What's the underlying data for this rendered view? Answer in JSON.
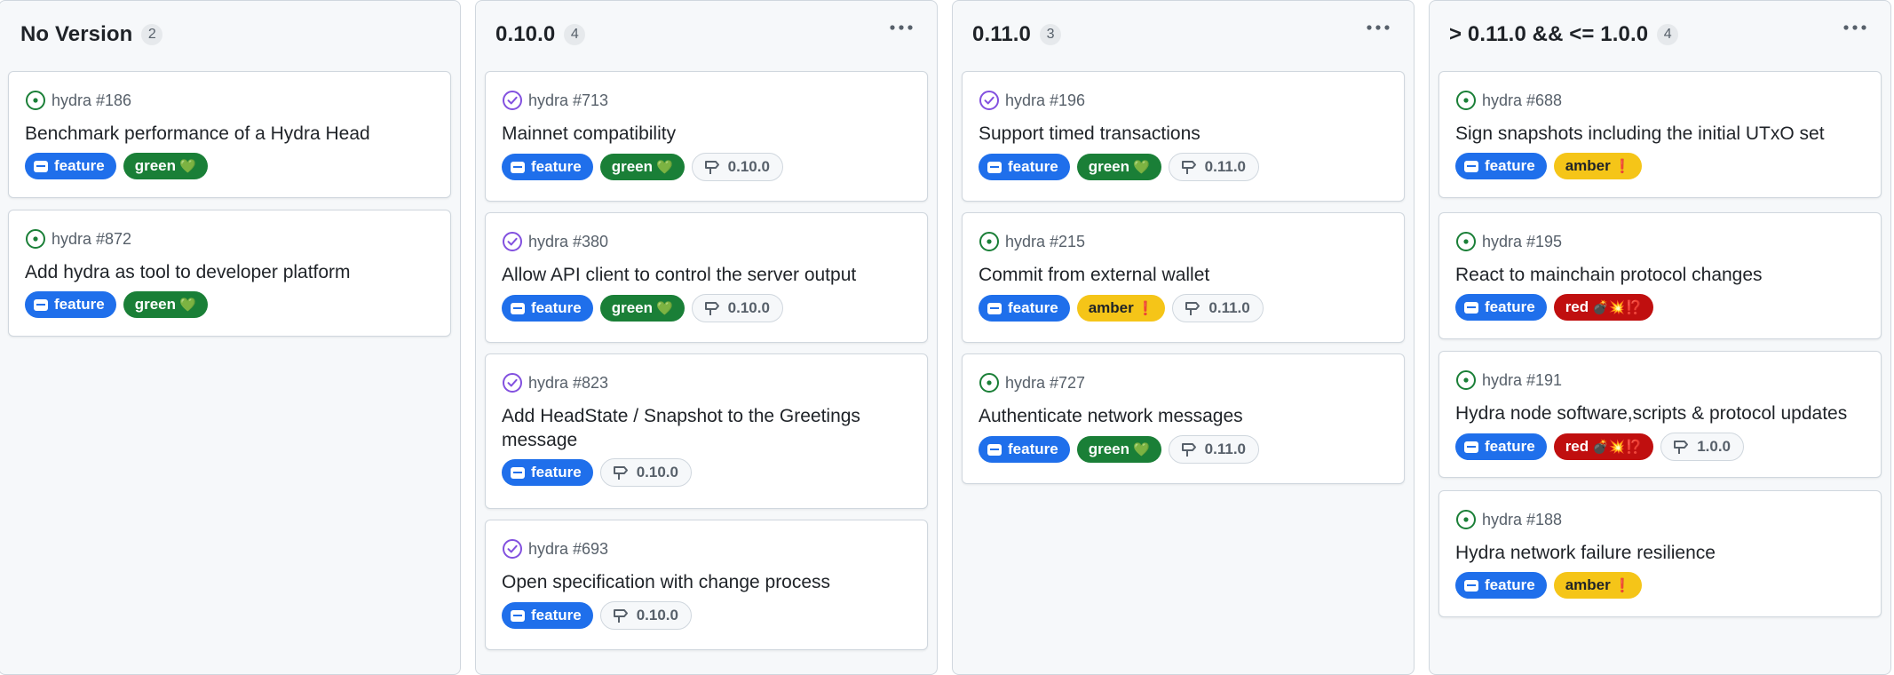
{
  "columns": [
    {
      "title": "No Version",
      "count": "2",
      "cards": [
        {
          "ref": "hydra #186",
          "status": "open",
          "title": "Benchmark performance of a Hydra Head",
          "labels": [
            {
              "name": "feature",
              "kind": "feature"
            },
            {
              "name": "green",
              "kind": "green",
              "emoji": "💚"
            }
          ],
          "milestone": ""
        },
        {
          "ref": "hydra #872",
          "status": "open",
          "title": "Add hydra as tool to developer platform",
          "labels": [
            {
              "name": "feature",
              "kind": "feature"
            },
            {
              "name": "green",
              "kind": "green",
              "emoji": "💚"
            }
          ],
          "milestone": ""
        }
      ]
    },
    {
      "title": "0.10.0",
      "count": "4",
      "cards": [
        {
          "ref": "hydra #713",
          "status": "done",
          "title": "Mainnet compatibility",
          "labels": [
            {
              "name": "feature",
              "kind": "feature"
            },
            {
              "name": "green",
              "kind": "green",
              "emoji": "💚"
            }
          ],
          "milestone": "0.10.0"
        },
        {
          "ref": "hydra #380",
          "status": "done",
          "title": "Allow API client to control the server output",
          "labels": [
            {
              "name": "feature",
              "kind": "feature"
            },
            {
              "name": "green",
              "kind": "green",
              "emoji": "💚"
            }
          ],
          "milestone": "0.10.0"
        },
        {
          "ref": "hydra #823",
          "status": "done",
          "title": "Add HeadState / Snapshot to the Greetings message",
          "labels": [
            {
              "name": "feature",
              "kind": "feature"
            }
          ],
          "milestone": "0.10.0"
        },
        {
          "ref": "hydra #693",
          "status": "done",
          "title": "Open specification with change process",
          "labels": [
            {
              "name": "feature",
              "kind": "feature"
            }
          ],
          "milestone": "0.10.0"
        }
      ]
    },
    {
      "title": "0.11.0",
      "count": "3",
      "cards": [
        {
          "ref": "hydra #196",
          "status": "done",
          "title": "Support timed transactions",
          "labels": [
            {
              "name": "feature",
              "kind": "feature"
            },
            {
              "name": "green",
              "kind": "green",
              "emoji": "💚"
            }
          ],
          "milestone": "0.11.0"
        },
        {
          "ref": "hydra #215",
          "status": "open",
          "title": "Commit from external wallet",
          "labels": [
            {
              "name": "feature",
              "kind": "feature"
            },
            {
              "name": "amber",
              "kind": "amber",
              "emoji": "❗"
            }
          ],
          "milestone": "0.11.0"
        },
        {
          "ref": "hydra #727",
          "status": "open",
          "title": "Authenticate network messages",
          "labels": [
            {
              "name": "feature",
              "kind": "feature"
            },
            {
              "name": "green",
              "kind": "green",
              "emoji": "💚"
            }
          ],
          "milestone": "0.11.0"
        }
      ]
    },
    {
      "title": "> 0.11.0 && <= 1.0.0",
      "count": "4",
      "cards": [
        {
          "ref": "hydra #688",
          "status": "open",
          "title": "Sign snapshots including the initial UTxO set",
          "labels": [
            {
              "name": "feature",
              "kind": "feature"
            },
            {
              "name": "amber",
              "kind": "amber",
              "emoji": "❗"
            }
          ],
          "milestone": ""
        },
        {
          "ref": "hydra #195",
          "status": "open",
          "title": "React to mainchain protocol changes",
          "labels": [
            {
              "name": "feature",
              "kind": "feature"
            },
            {
              "name": "red",
              "kind": "red",
              "emoji": "💣💥⁉️"
            }
          ],
          "milestone": ""
        },
        {
          "ref": "hydra #191",
          "status": "open",
          "title": "Hydra node software,scripts & protocol updates",
          "labels": [
            {
              "name": "feature",
              "kind": "feature"
            },
            {
              "name": "red",
              "kind": "red",
              "emoji": "💣💥⁉️"
            }
          ],
          "milestone": "1.0.0"
        },
        {
          "ref": "hydra #188",
          "status": "open",
          "title": "Hydra network failure resilience",
          "labels": [
            {
              "name": "feature",
              "kind": "feature"
            },
            {
              "name": "amber",
              "kind": "amber",
              "emoji": "❗"
            }
          ],
          "milestone": ""
        }
      ]
    }
  ],
  "colors": {
    "open_status": "#1a7f37",
    "done_status": "#8250df",
    "feature": "#1f6feb",
    "green": "#1a7f37",
    "amber": "#f5c518",
    "red": "#c00f0f"
  },
  "icons": {
    "open": "issue-open-icon",
    "done": "issue-closed-icon",
    "feature_label": "comment-icon",
    "milestone": "milestone-icon",
    "column_menu": "kebab-horizontal-icon"
  }
}
